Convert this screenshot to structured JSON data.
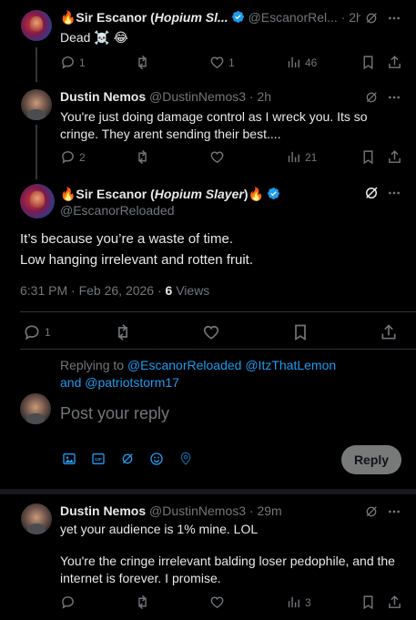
{
  "tweet1": {
    "name": "🔥Sir Escanor (",
    "name_italic": "Hopium Sl...",
    "handle": "@EscanorRel...",
    "time": "· 2h",
    "text": "Dead ☠️ 😂",
    "replies": "1",
    "likes": "1",
    "views": "46"
  },
  "tweet2": {
    "name": "Dustin Nemos",
    "handle": "@DustinNemos3 · 2h",
    "text": "You're just doing damage control as I wreck you. Its so cringe. They arent sending their best....",
    "replies": "2",
    "views": "21"
  },
  "main": {
    "name_prefix": "🔥Sir Escanor (",
    "name_italic": "Hopium Slayer",
    "name_suffix": ")🔥",
    "handle": "@EscanorReloaded",
    "line1": "It’s because you’re a waste of time.",
    "line2": "Low hanging irrelevant and rotten fruit.",
    "timestamp": "6:31 PM · Feb 26, 2026 · ",
    "views_count": "6",
    "views_label": " Views",
    "replies": "1"
  },
  "composer": {
    "replying_to": "Replying to ",
    "mention1": "@EscanorReloaded",
    "mention2": "@ItzThatLemon",
    "and": " and",
    "mention3": "@patriotstorm17",
    "placeholder": "Post your reply",
    "reply_button": "Reply"
  },
  "tweet3": {
    "name": "Dustin Nemos",
    "handle": "@DustinNemos3 · 29m",
    "text1": "yet your audience is 1% mine. LOL",
    "text2": "You're the cringe irrelevant balding loser pedophile, and the internet is forever. I promise.",
    "views": "3"
  },
  "colors": {
    "background": "#000000",
    "text": "#e7e9ea",
    "muted": "#71767b",
    "link": "#1d9bf0",
    "verified": "#1d9bf0",
    "divider": "#2f3336"
  }
}
